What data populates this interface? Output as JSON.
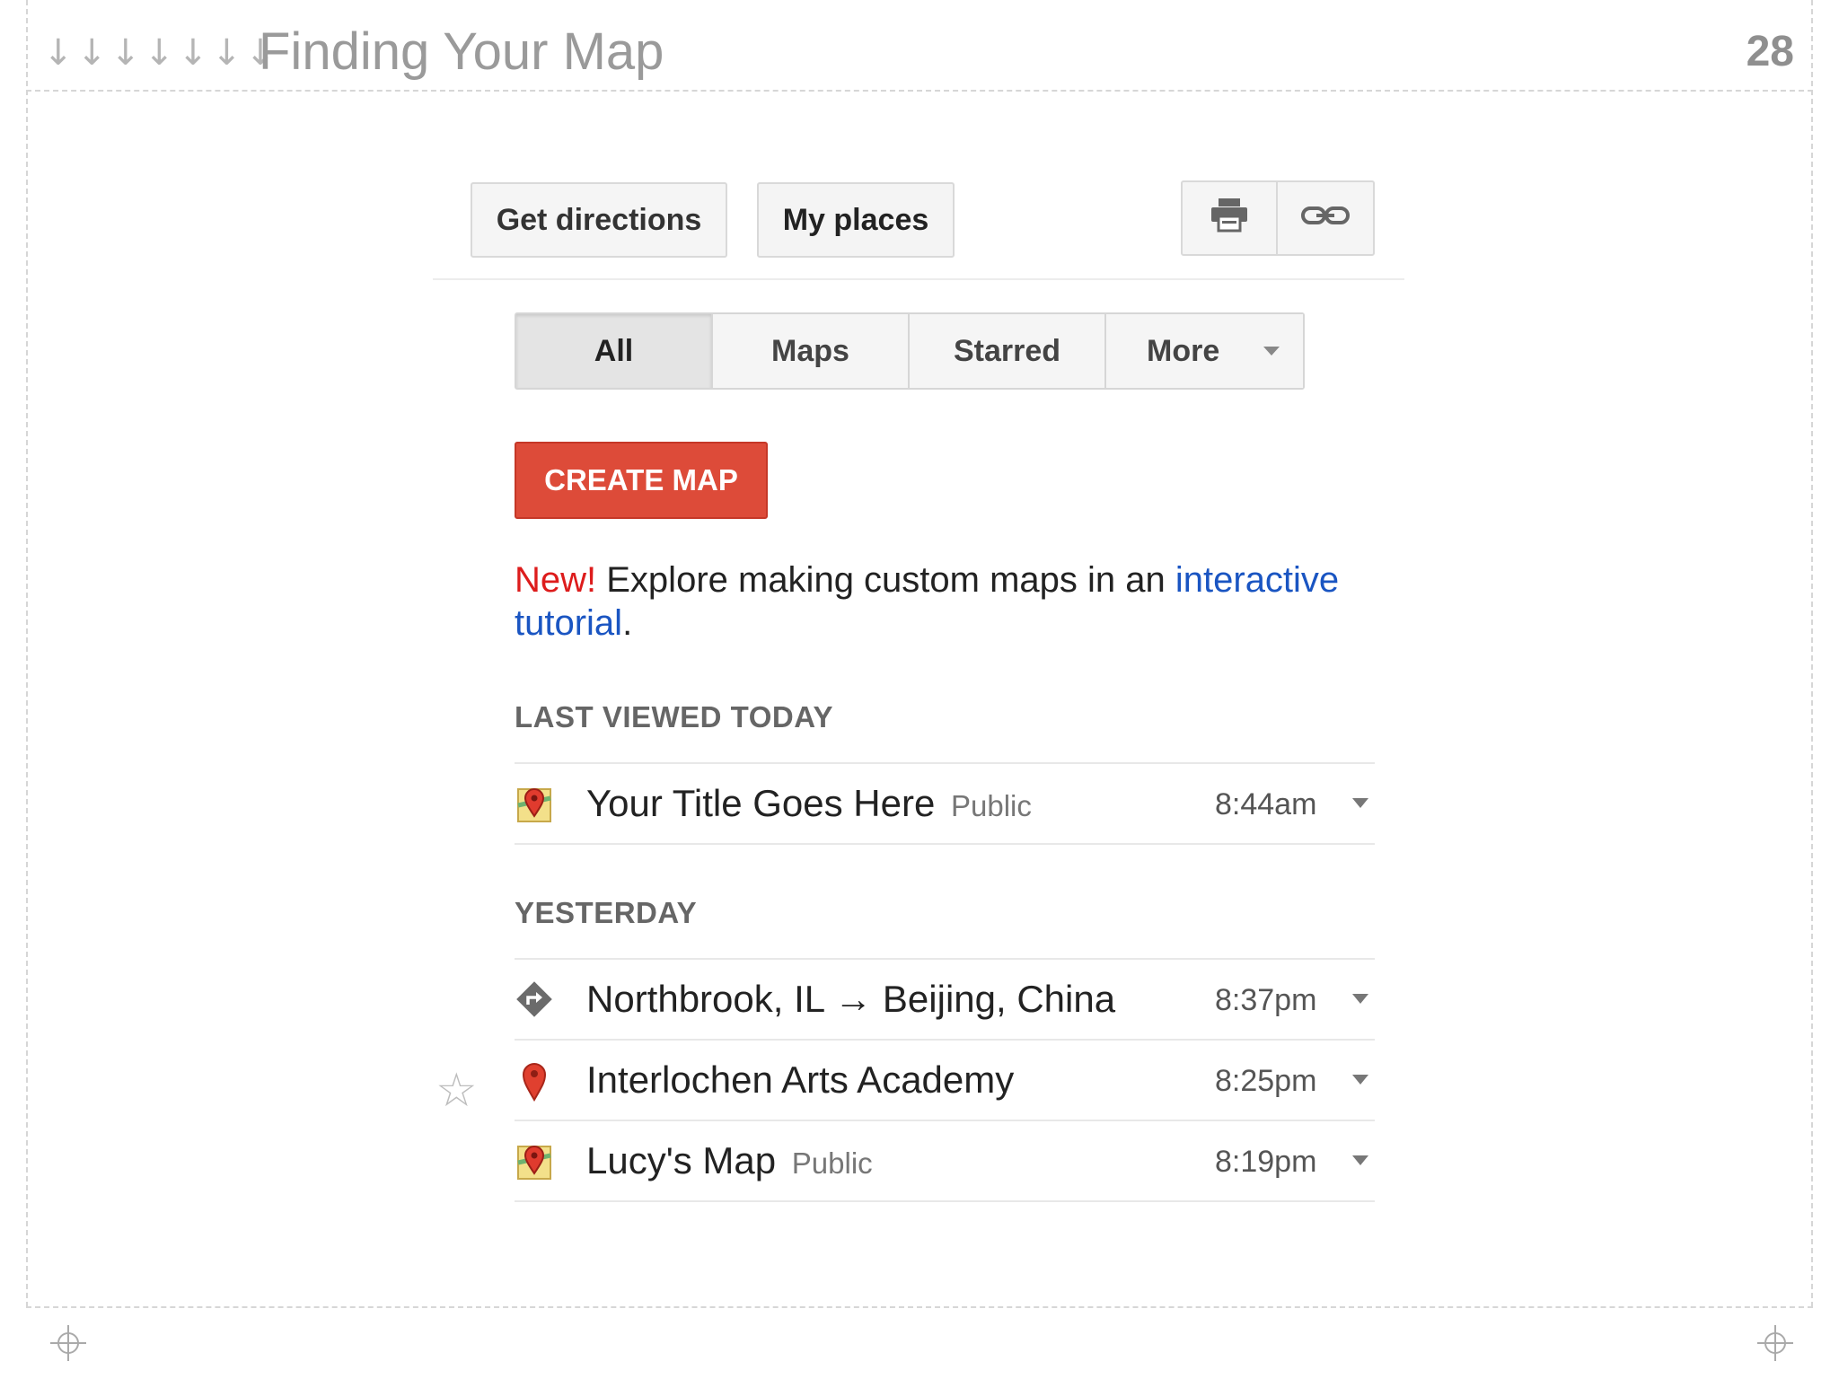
{
  "slide": {
    "arrows": "↓↓↓↓↓↓↓",
    "title": "Finding Your Map",
    "page_number": "28"
  },
  "toolbar": {
    "get_directions": "Get directions",
    "my_places": "My places"
  },
  "tabs": [
    {
      "label": "All",
      "active": true
    },
    {
      "label": "Maps",
      "active": false
    },
    {
      "label": "Starred",
      "active": false
    },
    {
      "label": "More",
      "active": false
    }
  ],
  "create_map": "CREATE MAP",
  "promo": {
    "new": "New!",
    "text": " Explore making custom maps in an ",
    "link": "interactive tutorial",
    "end": "."
  },
  "sections": [
    {
      "heading": "LAST VIEWED TODAY",
      "items": [
        {
          "name": "Your Title Goes Here",
          "tag": "Public",
          "time": "8:44am",
          "icon": "custom-map-icon"
        }
      ]
    },
    {
      "heading": "YESTERDAY",
      "items": [
        {
          "name": "Northbrook, IL → Beijing, China",
          "tag": "",
          "time": "8:37pm",
          "icon": "directions-icon"
        },
        {
          "name": "Interlochen Arts Academy",
          "tag": "",
          "time": "8:25pm",
          "icon": "red-pin-icon"
        },
        {
          "name": "Lucy's Map",
          "tag": "Public",
          "time": "8:19pm",
          "icon": "custom-map-icon"
        }
      ]
    }
  ],
  "colors": {
    "create_button": "#dd4b39",
    "new_label": "#dd1c1c",
    "link": "#1a55c2"
  }
}
